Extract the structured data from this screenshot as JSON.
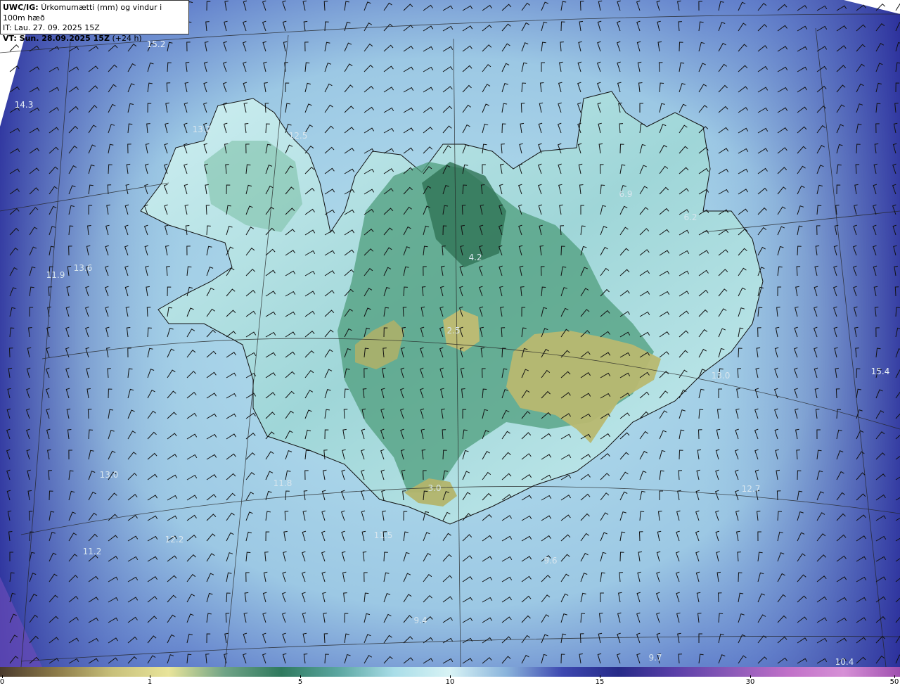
{
  "header": {
    "model": "UWC/IG:",
    "title": "Úrkomumætti (mm) og vindur i 100m hæð",
    "init_line": "IT: Lau. 27. 09. 2025 15Z",
    "valid_prefix": "VT: Sun. 28.09.2025 15Z",
    "valid_suffix": "(+24 h)"
  },
  "colors": {
    "ocean_deep": "#2a2d9a",
    "ocean_mid": "#5a76c8",
    "light_blue": "#a9d8e8",
    "pale": "#d5f1f4",
    "green": "#3f8f6e",
    "dark_green": "#2f7355",
    "yellow_green": "#b6b86c",
    "purple": "#7b5fc0"
  },
  "value_labels": [
    {
      "text": "15.2",
      "tone": "dark"
    },
    {
      "text": "14.3",
      "tone": "dark"
    },
    {
      "text": "13.2",
      "tone": "light"
    },
    {
      "text": "12.5",
      "tone": "light"
    },
    {
      "text": "4.2",
      "tone": "light"
    },
    {
      "text": "6.9",
      "tone": "light"
    },
    {
      "text": "6.2",
      "tone": "light"
    },
    {
      "text": "13.6",
      "tone": "light"
    },
    {
      "text": "11.9",
      "tone": "light"
    },
    {
      "text": "2.5",
      "tone": "light"
    },
    {
      "text": "15.4",
      "tone": "dark"
    },
    {
      "text": "13.0",
      "tone": "light"
    },
    {
      "text": "13.0",
      "tone": "light"
    },
    {
      "text": "11.8",
      "tone": "light"
    },
    {
      "text": "3.0",
      "tone": "light"
    },
    {
      "text": "12.7",
      "tone": "light"
    },
    {
      "text": "12.2",
      "tone": "light"
    },
    {
      "text": "11.2",
      "tone": "light"
    },
    {
      "text": "11.5",
      "tone": "light"
    },
    {
      "text": "9.6",
      "tone": "light"
    },
    {
      "text": "9.4",
      "tone": "light"
    },
    {
      "text": "9.7",
      "tone": "light"
    },
    {
      "text": "10.4",
      "tone": "light"
    }
  ],
  "colorbar": {
    "ticks": [
      "0",
      "1",
      "5",
      "10",
      "15",
      "30",
      "50"
    ],
    "stops": [
      "#4a3a2c",
      "#8c7a48",
      "#c8c07a",
      "#e8e49a",
      "#6fa386",
      "#2f7a5e",
      "#5aa6a0",
      "#a9dde8",
      "#d8f3f5",
      "#8ab4dc",
      "#3d48b0",
      "#262a88",
      "#5a3fa8",
      "#8b5ab8",
      "#c070c8",
      "#d690d6",
      "#a050b0"
    ]
  }
}
